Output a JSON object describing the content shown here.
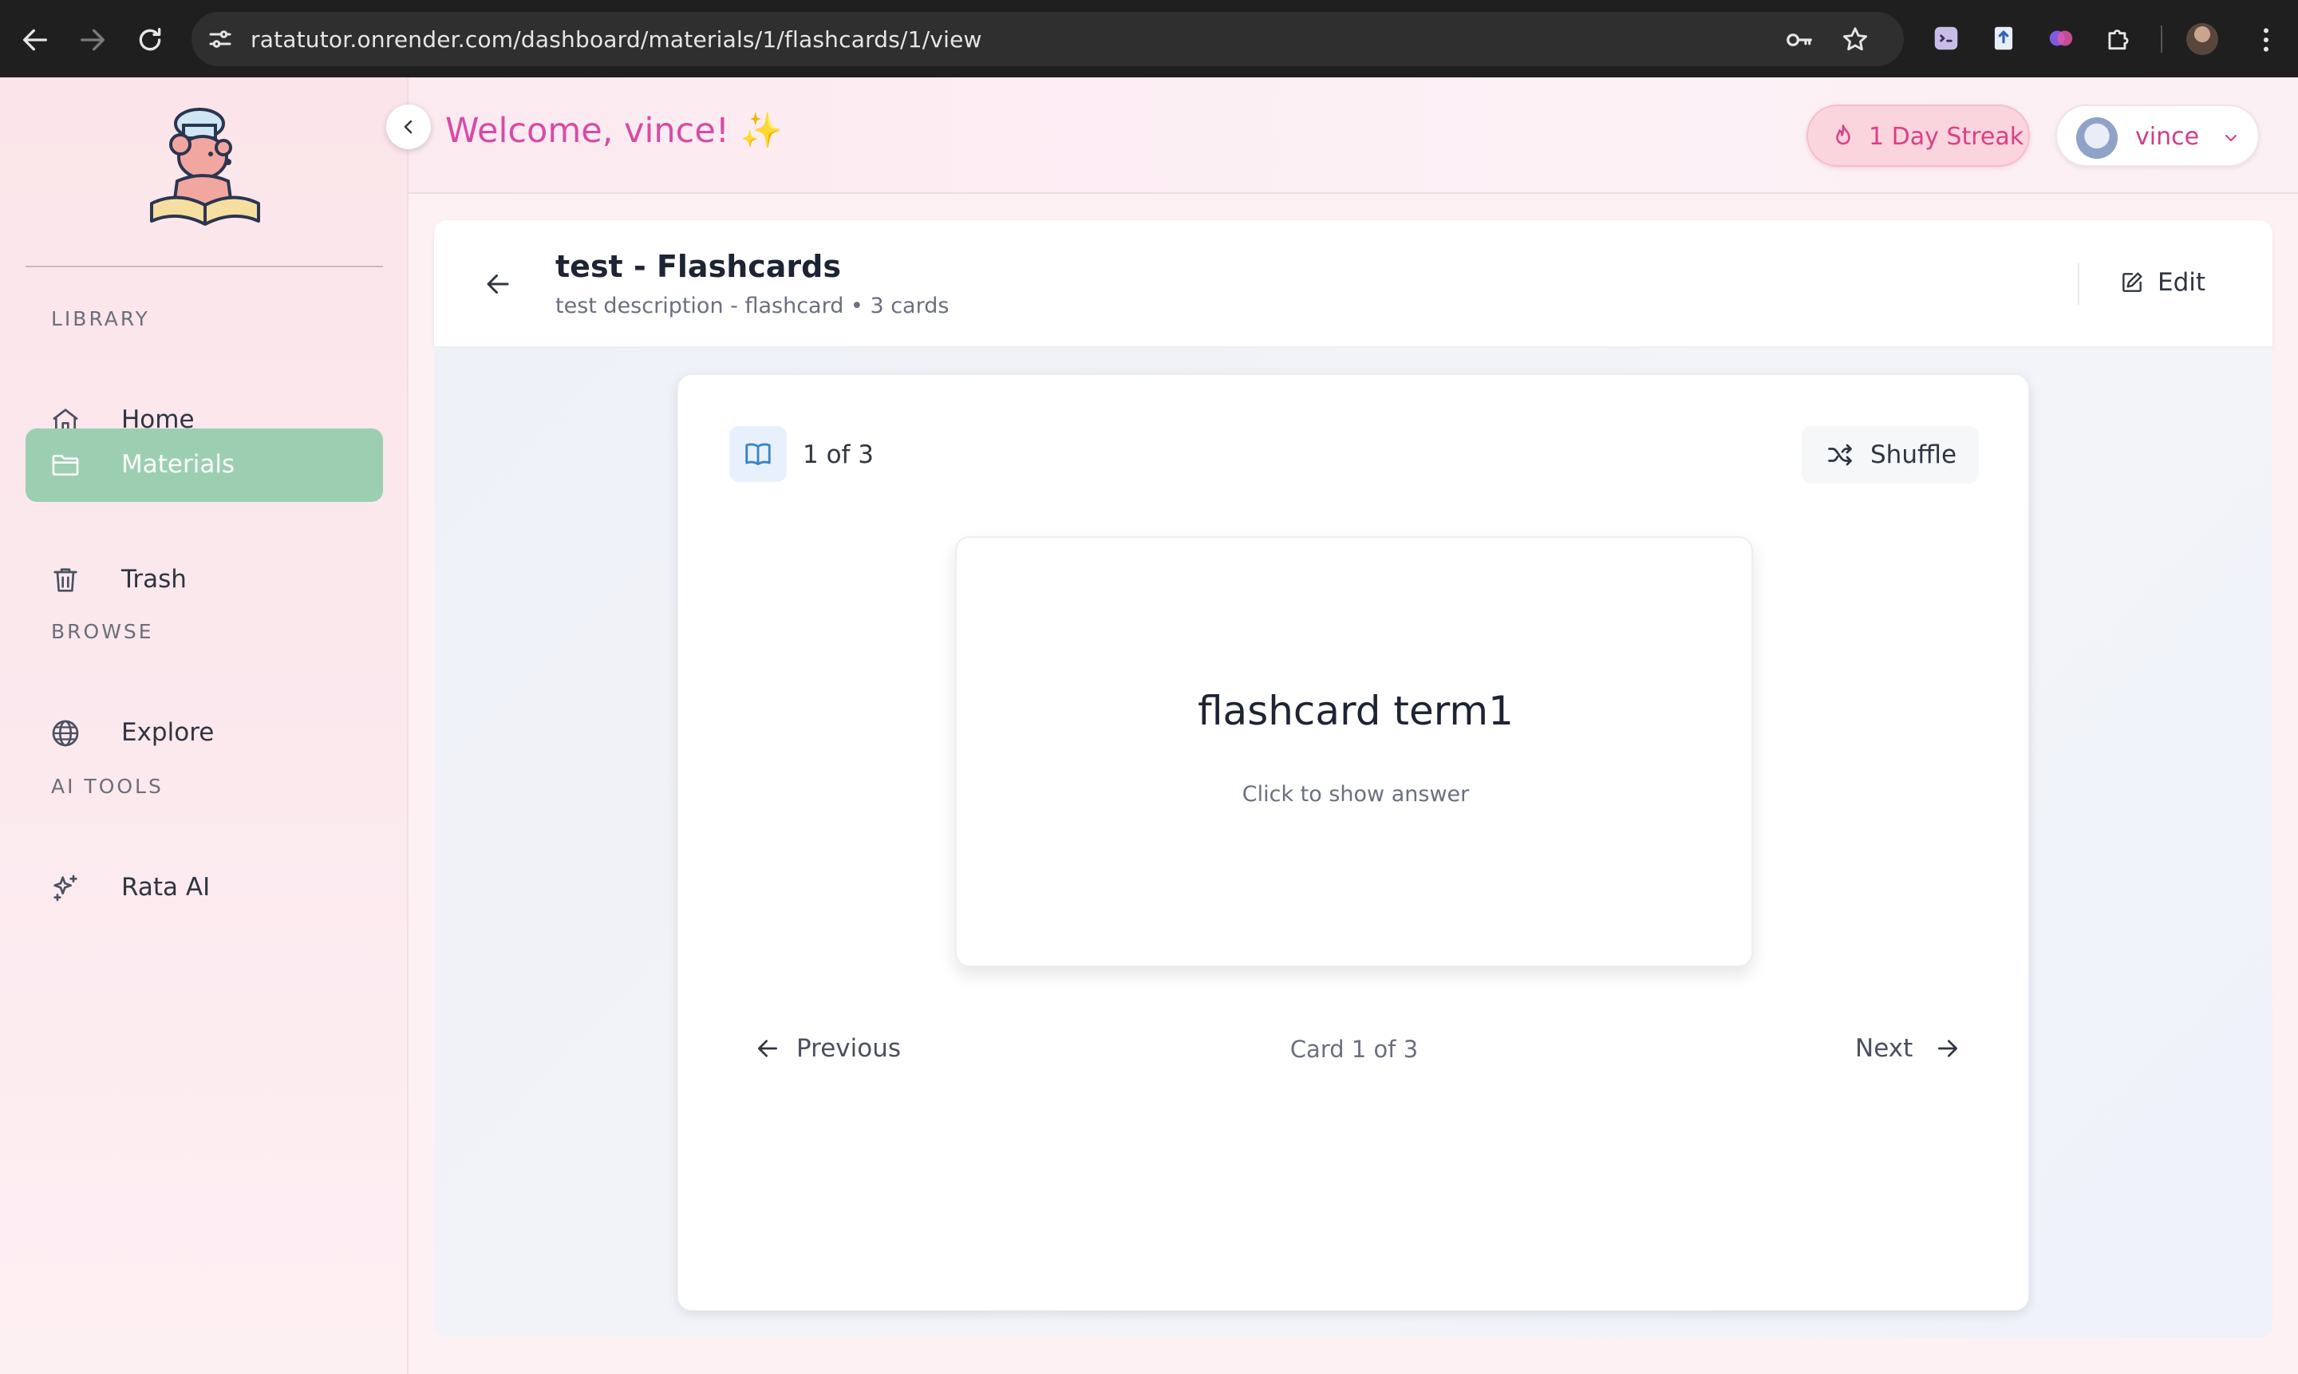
{
  "browser": {
    "url": "ratatutor.onrender.com/dashboard/materials/1/flashcards/1/view",
    "icons": [
      "back-icon",
      "forward-icon",
      "reload-icon",
      "site-settings-icon",
      "key-icon",
      "bookmark-star-icon",
      "extension-icon",
      "puzzle-icon",
      "more-icon"
    ]
  },
  "sidebar": {
    "sections": {
      "library": "LIBRARY",
      "browse": "BROWSE",
      "ai_tools": "AI TOOLS"
    },
    "items": [
      {
        "label": "Home",
        "icon": "home-icon",
        "active": false
      },
      {
        "label": "Materials",
        "icon": "folder-icon",
        "active": true
      },
      {
        "label": "Trash",
        "icon": "trash-icon",
        "active": false
      },
      {
        "label": "Explore",
        "icon": "globe-icon",
        "active": false
      },
      {
        "label": "Rata AI",
        "icon": "sparkles-icon",
        "active": false
      }
    ]
  },
  "header": {
    "welcome": "Welcome, vince! ✨",
    "streak": "1 Day Streak",
    "username": "vince"
  },
  "page": {
    "title": "test - Flashcards",
    "subtitle": "test description - flashcard • 3 cards",
    "edit_label": "Edit"
  },
  "study": {
    "counter": "1 of 3",
    "shuffle_label": "Shuffle",
    "term": "flashcard term1",
    "hint": "Click to show answer",
    "previous_label": "Previous",
    "position": "Card 1 of 3",
    "next_label": "Next"
  },
  "colors": {
    "accent_pink": "#d84aa5",
    "active_nav": "#9ccfb2",
    "streak_bg": "#fbd5dd",
    "streak_text": "#dc3f86"
  }
}
